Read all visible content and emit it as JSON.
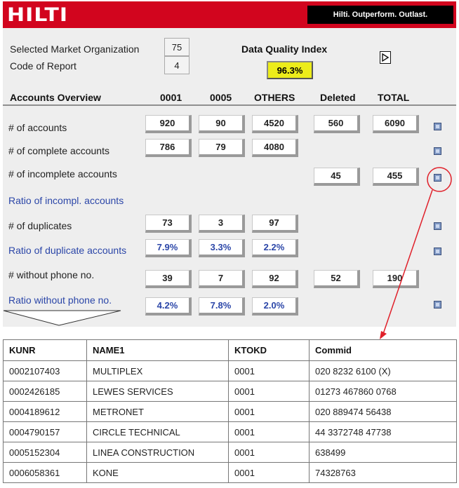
{
  "header": {
    "logo": "HILTI",
    "tagline": "Hilti. Outperform. Outlast."
  },
  "selection": {
    "market_org_label": "Selected Market Organization",
    "market_org_value": "75",
    "report_code_label": "Code of Report",
    "report_code_value": "4"
  },
  "dqi": {
    "label": "Data Quality Index",
    "value": "96.3%",
    "color": "#ecec1a"
  },
  "overview": {
    "title": "Accounts Overview",
    "columns": [
      "0001",
      "0005",
      "OTHERS",
      "Deleted",
      "TOTAL"
    ],
    "rows": [
      {
        "label": "# of accounts",
        "values": [
          "920",
          "90",
          "4520",
          "560",
          "6090"
        ]
      },
      {
        "label": "# of complete accounts",
        "values": [
          "786",
          "79",
          "4080",
          "",
          ""
        ]
      },
      {
        "label": "# of incomplete accounts",
        "values": [
          "",
          "",
          "",
          "45",
          "455"
        ]
      },
      {
        "label": "Ratio of incompl. accounts",
        "values": [
          "",
          "",
          "",
          "",
          ""
        ]
      },
      {
        "label": "# of duplicates",
        "values": [
          "73",
          "3",
          "97",
          "",
          ""
        ]
      },
      {
        "label": "Ratio of duplicate accounts",
        "values": [
          "7.9%",
          "3.3%",
          "2.2%",
          "",
          ""
        ]
      },
      {
        "label": "# without phone no.",
        "values": [
          "39",
          "7",
          "92",
          "52",
          "190"
        ]
      },
      {
        "label": "Ratio without phone no.",
        "values": [
          "4.2%",
          "7.8%",
          "2.0%",
          "",
          ""
        ]
      }
    ]
  },
  "detail_table": {
    "headers": [
      "KUNR",
      "NAME1",
      "KTOKD",
      "Commid"
    ],
    "rows": [
      [
        "0002107403",
        "MULTIPLEX",
        "0001",
        "020 8232 6100 (X)"
      ],
      [
        "0002426185",
        "LEWES SERVICES",
        "0001",
        "01273 467860 0768"
      ],
      [
        "0004189612",
        "METRONET",
        "0001",
        "020 889474 56438"
      ],
      [
        "0004790157",
        "CIRCLE TECHNICAL",
        "0001",
        "44 3372748 47738"
      ],
      [
        "0005152304",
        "LINEA CONSTRUCTION",
        "0001",
        "638499"
      ],
      [
        "0006058361",
        "KONE",
        "0001",
        "74328763"
      ]
    ]
  },
  "colors": {
    "brand_red": "#d2051e",
    "ratio_text": "#2b46a8",
    "annotation": "#e0202a"
  }
}
